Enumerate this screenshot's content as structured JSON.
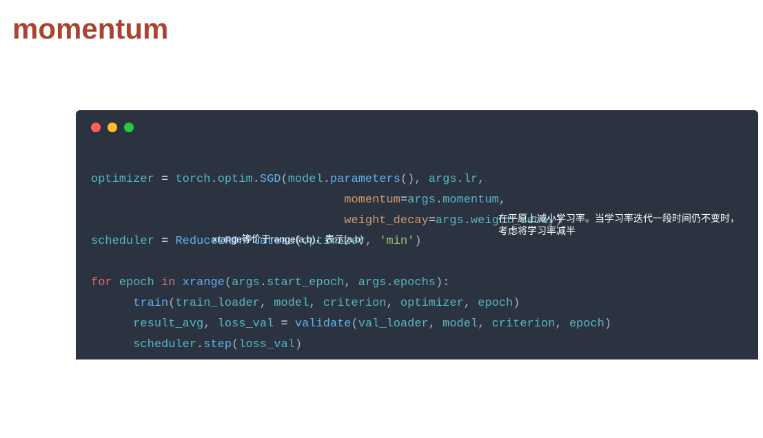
{
  "title": "momentum",
  "annotations": {
    "plateau": "在平原上减小学习率。当学习率迭代一段时间仍不变时，考虑将学习率减半",
    "xrange": "xrange等价于range(a,b)，表示[a,b)"
  },
  "code": {
    "line1": {
      "var": "optimizer",
      "eq": " = ",
      "mod1": "torch",
      "dot1": ".",
      "mod2": "optim",
      "dot2": ".",
      "cls": "SGD",
      "open": "(",
      "arg1a": "model",
      "dot3": ".",
      "arg1b": "parameters",
      "call1": "()",
      "comma1": ", ",
      "arg2a": "args",
      "dot4": ".",
      "arg2b": "lr",
      "comma2": ","
    },
    "line2": {
      "pad": "                                    ",
      "kw": "momentum",
      "eq": "=",
      "vala": "args",
      "dot": ".",
      "valb": "momentum",
      "comma": ","
    },
    "line3": {
      "pad": "                                    ",
      "kw": "weight_decay",
      "eq": "=",
      "vala": "args",
      "dot": ".",
      "valb": "weight_decay",
      "close": ")"
    },
    "line4": {
      "var": "scheduler",
      "eq": " = ",
      "cls": "ReduceLROnPlateau",
      "open": "(",
      "arg1": "optimizer",
      "comma": ", ",
      "str": "'min'",
      "close": ")"
    },
    "line5": {
      "kw1": "for",
      "sp1": " ",
      "var": "epoch",
      "sp2": " ",
      "kw2": "in",
      "sp3": " ",
      "fn": "xrange",
      "open": "(",
      "a1a": "args",
      "dot1": ".",
      "a1b": "start_epoch",
      "comma": ", ",
      "a2a": "args",
      "dot2": ".",
      "a2b": "epochs",
      "close": "):"
    },
    "line6": {
      "pad": "      ",
      "fn": "train",
      "open": "(",
      "a1": "train_loader",
      "c1": ", ",
      "a2": "model",
      "c2": ", ",
      "a3": "criterion",
      "c3": ", ",
      "a4": "optimizer",
      "c4": ", ",
      "a5": "epoch",
      "close": ")"
    },
    "line7": {
      "pad": "      ",
      "v1": "result_avg",
      "c1": ", ",
      "v2": "loss_val",
      "eq": " = ",
      "fn": "validate",
      "open": "(",
      "a1": "val_loader",
      "cc1": ", ",
      "a2": "model",
      "cc2": ", ",
      "a3": "criterion",
      "cc3": ", ",
      "a4": "epoch",
      "close": ")"
    },
    "line8": {
      "pad": "      ",
      "obj": "scheduler",
      "dot": ".",
      "fn": "step",
      "open": "(",
      "arg": "loss_val",
      "close": ")"
    }
  }
}
